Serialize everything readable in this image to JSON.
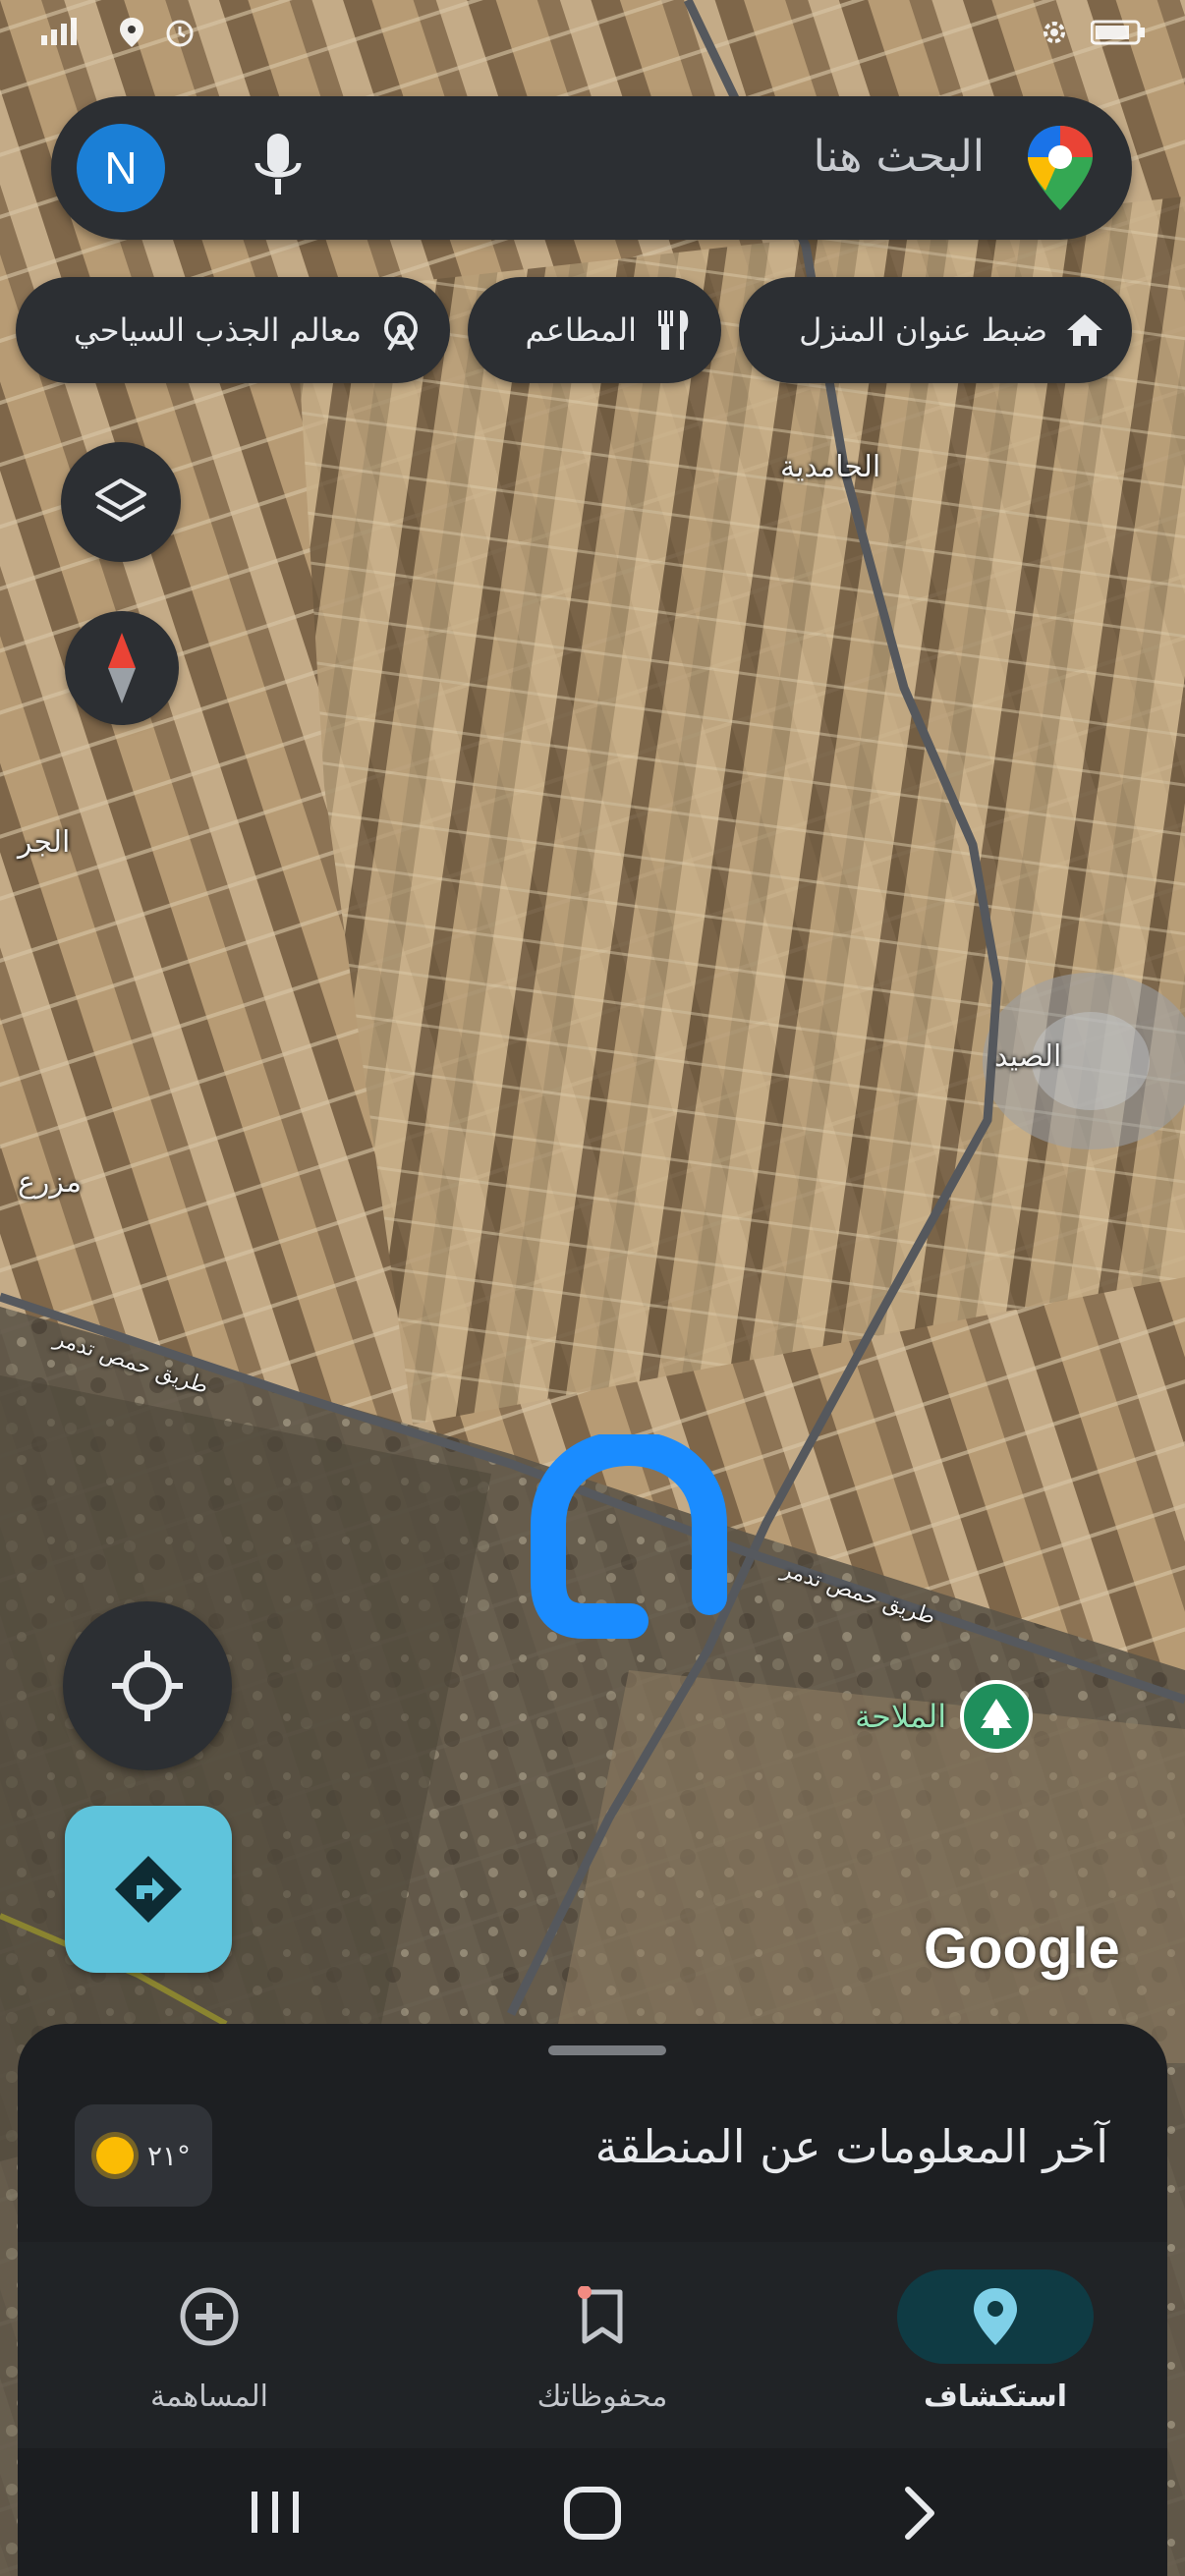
{
  "status_bar": {
    "left_icons": [
      "signal-icon",
      "location-icon",
      "alarm-icon"
    ],
    "right_icons": [
      "settings-icon",
      "battery-icon"
    ]
  },
  "search": {
    "avatar_letter": "N",
    "placeholder": "البحث هنا"
  },
  "chips": [
    {
      "label": "ضبط عنوان المنزل",
      "icon": "home-icon"
    },
    {
      "label": "المطاعم",
      "icon": "restaurant-icon"
    },
    {
      "label": "معالم الجذب السياحي",
      "icon": "attractions-icon"
    }
  ],
  "map": {
    "labels": {
      "hamidiya": "الحامدية",
      "sayd": "الصيد",
      "left_edge_top": "الجر",
      "left_edge_mid": "مزرع",
      "road_left": "طريق حمص تدمر",
      "road_right": "طريق حمص تدمر"
    },
    "poi": {
      "label": "الملاحة",
      "icon": "park-tree-icon"
    },
    "watermark": "Google",
    "marker_color": "#1a8cff"
  },
  "sheet": {
    "title": "آخر المعلومات عن المنطقة",
    "weather": "٢١°"
  },
  "tabs": [
    {
      "label": "استكشاف",
      "icon": "explore-pin-icon",
      "active": true
    },
    {
      "label": "محفوظاتك",
      "icon": "bookmark-icon",
      "active": false
    },
    {
      "label": "المساهمة",
      "icon": "add-circle-icon",
      "active": false
    }
  ],
  "colors": {
    "panel": "#2c2f33",
    "active_tab": "#0f3b44",
    "active_accent": "#7fd0e8",
    "directions_button": "#5fc4dc"
  }
}
